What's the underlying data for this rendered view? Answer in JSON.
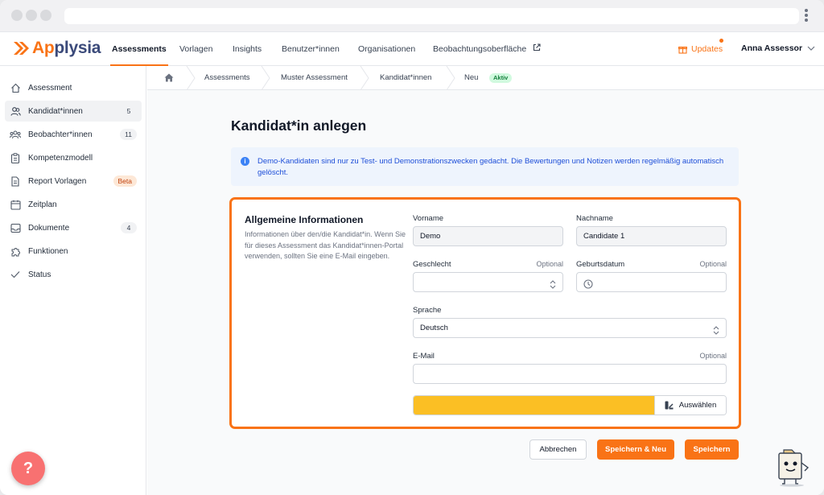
{
  "app": {
    "logo_text_a": "Ap",
    "logo_text_b": "plysia"
  },
  "nav": {
    "tabs": [
      {
        "label": "Assessments"
      },
      {
        "label": "Vorlagen"
      },
      {
        "label": "Insights"
      },
      {
        "label": "Benutzer*innen"
      },
      {
        "label": "Organisationen"
      },
      {
        "label": "Beobachtungsoberfläche"
      }
    ],
    "updates": "Updates",
    "user": "Anna Assessor"
  },
  "sidebar": {
    "items": [
      {
        "label": "Assessment",
        "icon": "home-icon"
      },
      {
        "label": "Kandidat*innen",
        "badge": "5",
        "icon": "users-icon"
      },
      {
        "label": "Beobachter*innen",
        "badge": "11",
        "icon": "group-icon"
      },
      {
        "label": "Kompetenzmodell",
        "icon": "clipboard-icon"
      },
      {
        "label": "Report Vorlagen",
        "badge": "Beta",
        "icon": "document-icon"
      },
      {
        "label": "Zeitplan",
        "icon": "calendar-icon"
      },
      {
        "label": "Dokumente",
        "badge": "4",
        "icon": "inbox-icon"
      },
      {
        "label": "Funktionen",
        "icon": "puzzle-icon"
      },
      {
        "label": "Status",
        "icon": "check-icon"
      }
    ],
    "help": "?"
  },
  "breadcrumb": {
    "items": [
      "Assessments",
      "Muster Assessment",
      "Kandidat*innen",
      "Neu"
    ],
    "status": "Aktiv"
  },
  "page": {
    "title": "Kandidat*in anlegen",
    "info": "Demo-Kandidaten sind nur zu Test- und Demonstrationszwecken gedacht. Die Bewertungen und Notizen werden regelmäßig automatisch gelöscht.",
    "section_title": "Allgemeine Informationen",
    "section_desc": "Informationen über den/die Kandidat*in. Wenn Sie für dieses Assessment das Kandidat*innen-Portal verwenden, sollten Sie eine E-Mail eingeben.",
    "optional": "Optional"
  },
  "form": {
    "vorname": {
      "label": "Vorname",
      "value": "Demo"
    },
    "nachname": {
      "label": "Nachname",
      "value": "Candidate 1"
    },
    "geschlecht": {
      "label": "Geschlecht",
      "value": ""
    },
    "geburtsdatum": {
      "label": "Geburtsdatum",
      "value": ""
    },
    "sprache": {
      "label": "Sprache",
      "value": "Deutsch"
    },
    "email": {
      "label": "E-Mail",
      "value": ""
    },
    "color_picker": {
      "button": "Auswählen",
      "color": "#fbbf24"
    }
  },
  "buttons": {
    "cancel": "Abbrechen",
    "save_new": "Speichern & Neu",
    "save": "Speichern"
  },
  "colors": {
    "accent": "#f97316",
    "info_text": "#1d4ed8",
    "status_green": "#15803d"
  }
}
